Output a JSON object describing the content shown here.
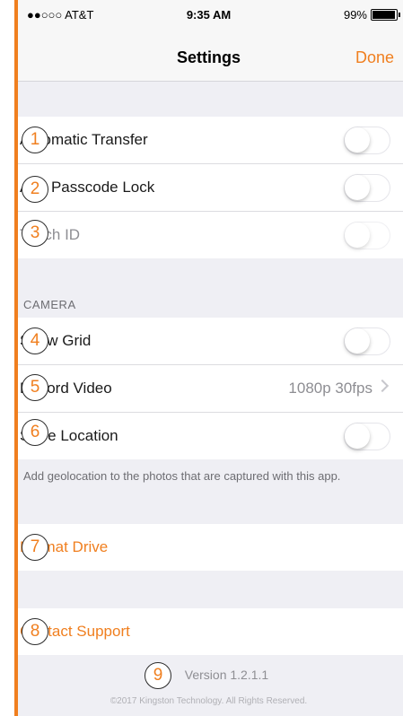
{
  "status_bar": {
    "carrier": "●●○○○ AT&T",
    "time": "9:35 AM",
    "battery": "99%"
  },
  "nav": {
    "title": "Settings",
    "done_label": "Done"
  },
  "security": {
    "automatic_transfer": "Automatic Transfer",
    "app_passcode_lock": "App Passcode Lock",
    "touch_id": "Touch ID"
  },
  "camera": {
    "header": "CAMERA",
    "show_grid": "Show Grid",
    "record_video": "Record Video",
    "record_video_value": "1080p 30fps",
    "store_location": "Store Location",
    "footer": "Add geolocation to the photos that are captured with this app."
  },
  "drive": {
    "format_drive": "Format Drive"
  },
  "support": {
    "contact_support": "Contact Support"
  },
  "about": {
    "version": "Version 1.2.1.1",
    "copyright": "©2017 Kingston Technology. All Rights Reserved."
  },
  "callouts": [
    "1",
    "2",
    "3",
    "4",
    "5",
    "6",
    "7",
    "8",
    "9"
  ],
  "colors": {
    "accent": "#f07f1f",
    "background": "#efeff4"
  }
}
